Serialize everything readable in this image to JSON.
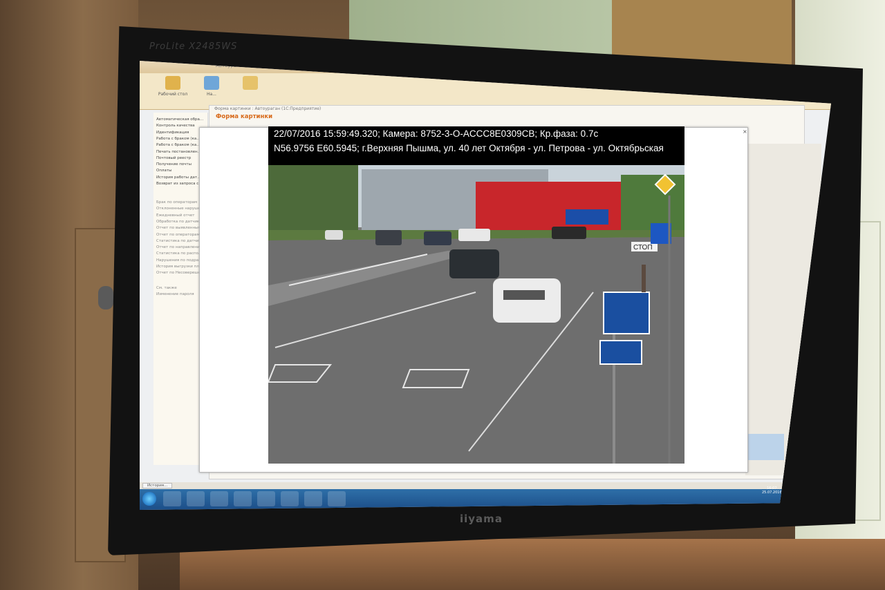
{
  "monitor": {
    "model": "ProLite X2485WS",
    "brand": "iiyama"
  },
  "app": {
    "title": "Автоураган — 1С:Предприятие",
    "ribbon": [
      "Рабочий стол",
      "На..."
    ],
    "nav_items": [
      "Автоматическая обра...",
      "Контроль качества",
      "Идентификация",
      "Работа с браком (ка...",
      "Работа с браком (ка...",
      "Печать постановлен...",
      "Почтовый реестр",
      "Получение почты",
      "Оплаты",
      "История работы дат...",
      "Возврат из запроса с..."
    ],
    "report_items": [
      "Брак по операторам",
      "Отклоненные нарушения",
      "Ежедневный отчет",
      "Обработка по датчикам",
      "Отчет по выявленным н...",
      "Отчет по операторам",
      "Статистика по датчикам",
      "Отчет по направлениям",
      "Статистика по располо...",
      "Нарушения по подразд...",
      "История выгрузки плате...",
      "Отчет по Несоверешен..."
    ],
    "extra_items": [
      "См. также",
      "Изменение пароля"
    ],
    "status_tab": "История...",
    "tray_time": "16:07",
    "tray_date": "25.07.2016"
  },
  "dialog": {
    "window_title": "Форма картинки : Автоураган (1С:Предприятие)",
    "heading": "Форма картинки",
    "close_label": "×"
  },
  "photo": {
    "caption_line1": "22/07/2016 15:59:49.320; Камера: 8752-3-О-ACCC8E0309CB; Кр.фаза: 0.7с",
    "caption_line2": "N56.9756 E60.5945; г.Верхняя Пышма, ул. 40 лет Октября - ул. Петрова - ул. Октябрьская",
    "stop_sign": "СТОП"
  }
}
